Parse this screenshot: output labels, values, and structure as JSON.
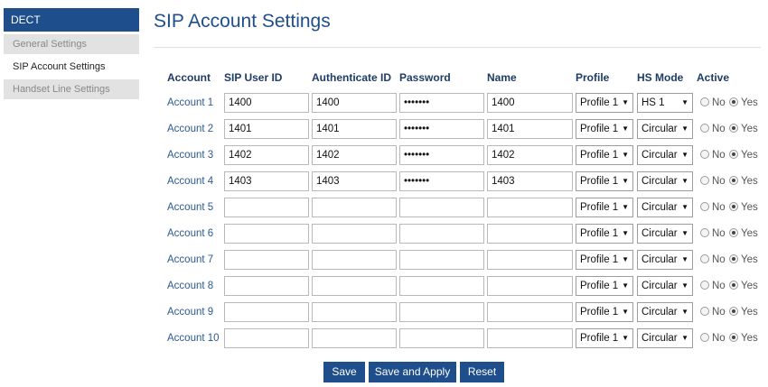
{
  "sidebar": {
    "header": "DECT",
    "items": [
      {
        "label": "General Settings"
      },
      {
        "label": "SIP Account Settings"
      },
      {
        "label": "Handset Line Settings"
      }
    ]
  },
  "title": "SIP Account Settings",
  "table": {
    "headers": [
      "Account",
      "SIP User ID",
      "Authenticate ID",
      "Password",
      "Name",
      "Profile",
      "HS Mode",
      "Active"
    ],
    "rows": [
      {
        "account": "Account 1",
        "sip_user_id": "1400",
        "auth_id": "1400",
        "password": "•••••••",
        "name": "1400",
        "profile": "Profile 1",
        "hs_mode": "HS 1",
        "active": "Yes"
      },
      {
        "account": "Account 2",
        "sip_user_id": "1401",
        "auth_id": "1401",
        "password": "•••••••",
        "name": "1401",
        "profile": "Profile 1",
        "hs_mode": "Circular",
        "active": "Yes"
      },
      {
        "account": "Account 3",
        "sip_user_id": "1402",
        "auth_id": "1402",
        "password": "•••••••",
        "name": "1402",
        "profile": "Profile 1",
        "hs_mode": "Circular",
        "active": "Yes"
      },
      {
        "account": "Account 4",
        "sip_user_id": "1403",
        "auth_id": "1403",
        "password": "•••••••",
        "name": "1403",
        "profile": "Profile 1",
        "hs_mode": "Circular",
        "active": "Yes"
      },
      {
        "account": "Account 5",
        "sip_user_id": "",
        "auth_id": "",
        "password": "",
        "name": "",
        "profile": "Profile 1",
        "hs_mode": "Circular",
        "active": "Yes"
      },
      {
        "account": "Account 6",
        "sip_user_id": "",
        "auth_id": "",
        "password": "",
        "name": "",
        "profile": "Profile 1",
        "hs_mode": "Circular",
        "active": "Yes"
      },
      {
        "account": "Account 7",
        "sip_user_id": "",
        "auth_id": "",
        "password": "",
        "name": "",
        "profile": "Profile 1",
        "hs_mode": "Circular",
        "active": "Yes"
      },
      {
        "account": "Account 8",
        "sip_user_id": "",
        "auth_id": "",
        "password": "",
        "name": "",
        "profile": "Profile 1",
        "hs_mode": "Circular",
        "active": "Yes"
      },
      {
        "account": "Account 9",
        "sip_user_id": "",
        "auth_id": "",
        "password": "",
        "name": "",
        "profile": "Profile 1",
        "hs_mode": "Circular",
        "active": "Yes"
      },
      {
        "account": "Account 10",
        "sip_user_id": "",
        "auth_id": "",
        "password": "",
        "name": "",
        "profile": "Profile 1",
        "hs_mode": "Circular",
        "active": "Yes"
      }
    ],
    "radio_labels": {
      "no": "No",
      "yes": "Yes"
    }
  },
  "buttons": {
    "save": "Save",
    "save_apply": "Save and Apply",
    "reset": "Reset"
  },
  "colors": {
    "brand": "#1f4e8c",
    "link": "#2c5a92"
  },
  "icons": {
    "dropdown": "triangle-down-icon",
    "radio": "radio-icon"
  }
}
